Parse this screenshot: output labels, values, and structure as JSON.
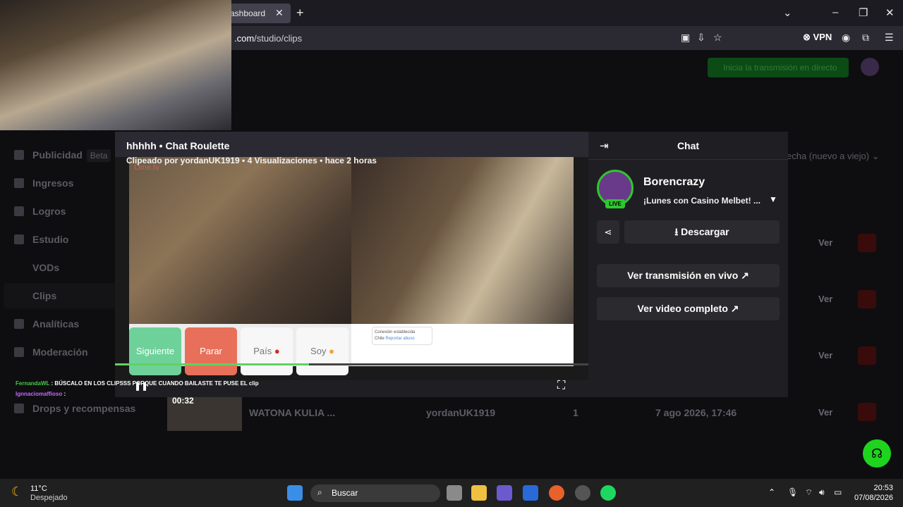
{
  "browser": {
    "tab_label": "ashboard",
    "url_host": ".com",
    "url_path": "/studio/clips",
    "vpn_label": "VPN"
  },
  "studio": {
    "live_button": "Inicia la transmisión en directo",
    "sidebar": [
      {
        "label": "Publicidad",
        "badge": "Beta"
      },
      {
        "label": "Ingresos"
      },
      {
        "label": "Logros"
      },
      {
        "label": "Estudio"
      },
      {
        "label": "VODs"
      },
      {
        "label": "Clips"
      },
      {
        "label": "Analíticas"
      },
      {
        "label": "Moderación"
      },
      {
        "label": "Drops y recompensas"
      }
    ],
    "sort_label": "echa (nuevo a viejo)",
    "row_action": "Ver",
    "row": {
      "duration": "00:32",
      "title": "WATONA KULIA ...",
      "author": "yordanUK1919",
      "views": "1",
      "date": "7 ago 2026, 17:46"
    }
  },
  "clip": {
    "title": "hhhhh • Chat Roulette",
    "meta": "Clipeado por yordanUK1919 • 4 Visualizaciones • hace 2 horas",
    "site_label": "Ome.tv",
    "buttons": {
      "next": "Siguiente",
      "stop": "Parar",
      "country": "País",
      "gender": "Soy"
    },
    "connection_text": "Conexión establecida",
    "country_text": "Chile",
    "report_text": "Reportar abuso",
    "progress": 0.41,
    "overlay_chat": [
      {
        "user": "FernandaWL",
        "text": ": BÚSCALO EN LOS CLIPSSS PORQUE CUANDO BAILASTE TE PUSE EL clip"
      },
      {
        "user": "Ignnaciomaffioso",
        "text": ":"
      }
    ]
  },
  "chat_panel": {
    "title": "Chat",
    "channel_name": "Borencrazy",
    "stream_title": "¡Lunes con Casino Melbet! ...",
    "live_badge": "LIVE",
    "download": "Descargar",
    "watch_live": "Ver transmisión en vivo",
    "watch_full": "Ver video completo"
  },
  "taskbar": {
    "temperature": "11°C",
    "weather": "Despejado",
    "search": "Buscar",
    "time": "20:53",
    "date": "07/08/2026"
  },
  "colors": {
    "accent_green": "#2ec82e",
    "next_button": "#6fd19a",
    "stop_button": "#e8705a"
  }
}
